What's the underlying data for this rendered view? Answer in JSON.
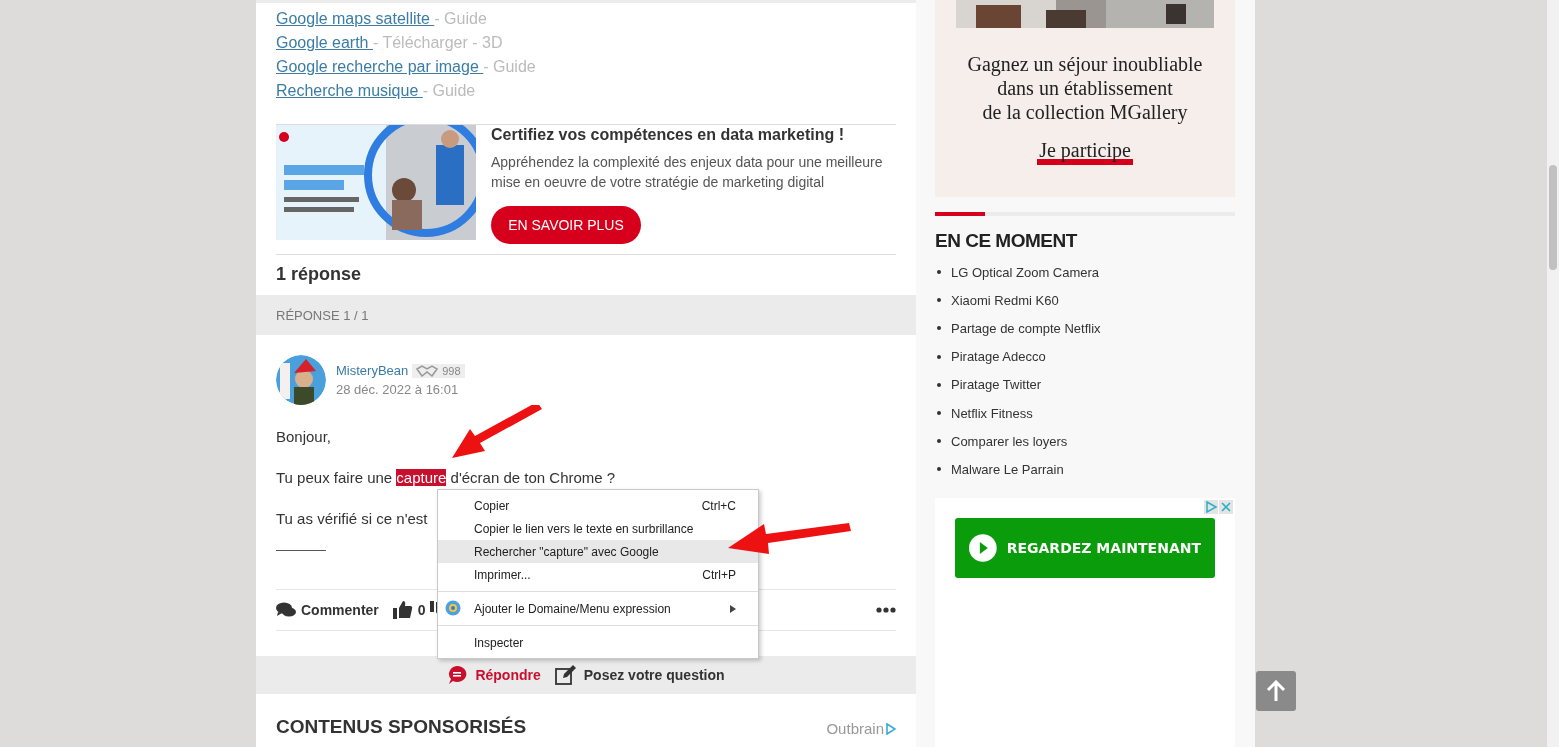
{
  "links": [
    {
      "text": "Google maps satellite ",
      "note": "- Guide"
    },
    {
      "text": "Google earth ",
      "note": "- Télécharger - 3D"
    },
    {
      "text": "Google recherche par image ",
      "note": "- Guide"
    },
    {
      "text": "Recherche musique ",
      "note": "- Guide"
    }
  ],
  "promo": {
    "kind": "picture",
    "title": "Certifiez vos compétences en data marketing !",
    "description": "Appréhendez la complexité des enjeux data pour une meilleure mise en oeuvre de votre stratégie de marketing digital",
    "button": "EN SAVOIR PLUS"
  },
  "responses_heading": "1 réponse",
  "response_bar": "RÉPONSE 1 / 1",
  "post": {
    "author": "MisteryBean",
    "reputation": "998",
    "date": "28 déc. 2022 à 16:01",
    "paragraphs": [
      {
        "before": "Bonjour,"
      },
      {
        "before": "Tu peux faire une ",
        "selection": "capture",
        "after": " d'écran de ton Chrome ?"
      },
      {
        "before": "Tu as vérifié si ce n'est"
      }
    ]
  },
  "actions": {
    "comment": "Commenter",
    "likes": "0"
  },
  "reply_bar": {
    "reply": "Répondre",
    "ask": "Posez votre question"
  },
  "sponsored": {
    "title": "CONTENUS SPONSORISÉS",
    "brand": "Outbrain"
  },
  "sidebar": {
    "ad": {
      "lines": [
        "Gagnez un séjour inoubliable",
        "dans un établissement",
        "de la collection MGallery"
      ],
      "cta": "Je participe"
    },
    "trending": {
      "title": "EN CE MOMENT",
      "items": [
        "LG Optical Zoom Camera",
        "Xiaomi Redmi K60",
        "Partage de compte Netflix",
        "Piratage Adecco",
        "Piratage Twitter",
        "Netflix Fitness",
        "Comparer les loyers",
        "Malware Le Parrain"
      ]
    },
    "video_ad": {
      "button": "REGARDEZ MAINTENANT"
    }
  },
  "context_menu": {
    "items": [
      {
        "kind": "item",
        "label": "Copier",
        "shortcut": "Ctrl+C",
        "selected": false
      },
      {
        "kind": "item",
        "label": "Copier le lien vers le texte en surbrillance",
        "selected": false
      },
      {
        "kind": "item",
        "label": "Rechercher \"capture\" avec Google",
        "selected": true
      },
      {
        "kind": "item",
        "label": "Imprimer...",
        "shortcut": "Ctrl+P",
        "selected": false
      },
      {
        "kind": "separator"
      },
      {
        "kind": "extension",
        "label": "Ajouter le Domaine/Menu expression",
        "submenu": true,
        "selected": false
      },
      {
        "kind": "separator"
      },
      {
        "kind": "item",
        "label": "Inspecter",
        "selected": false
      }
    ]
  }
}
